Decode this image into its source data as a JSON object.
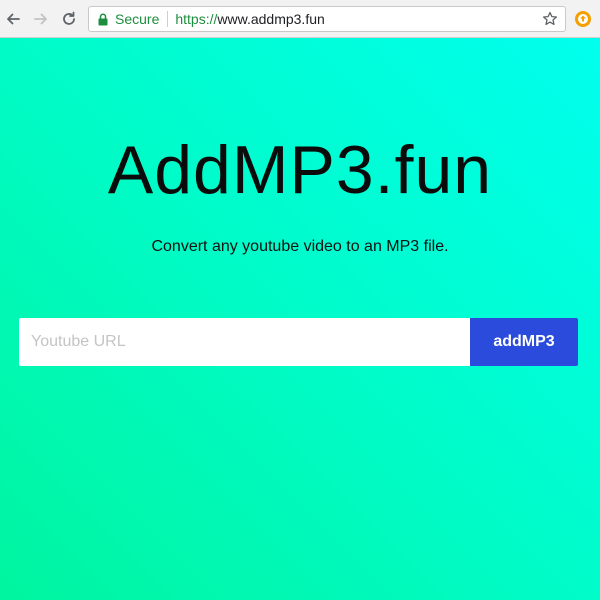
{
  "browser": {
    "secure_label": "Secure",
    "url_scheme": "https://",
    "url_host": "www.addmp3.fun",
    "icons": {
      "back": "back-arrow-icon",
      "forward": "forward-arrow-icon",
      "reload": "reload-icon",
      "lock": "lock-icon",
      "bookmark": "star-icon",
      "extension": "extension-icon"
    }
  },
  "page": {
    "title": "AddMP3.fun",
    "tagline": "Convert any youtube video to an MP3 file.",
    "form": {
      "placeholder": "Youtube URL",
      "value": "",
      "submit_label": "addMP3"
    }
  },
  "colors": {
    "secure_green": "#1e8e3e",
    "button_blue": "#2a4bdc",
    "gradient_start": "#00ffee",
    "gradient_end": "#00f59f"
  }
}
